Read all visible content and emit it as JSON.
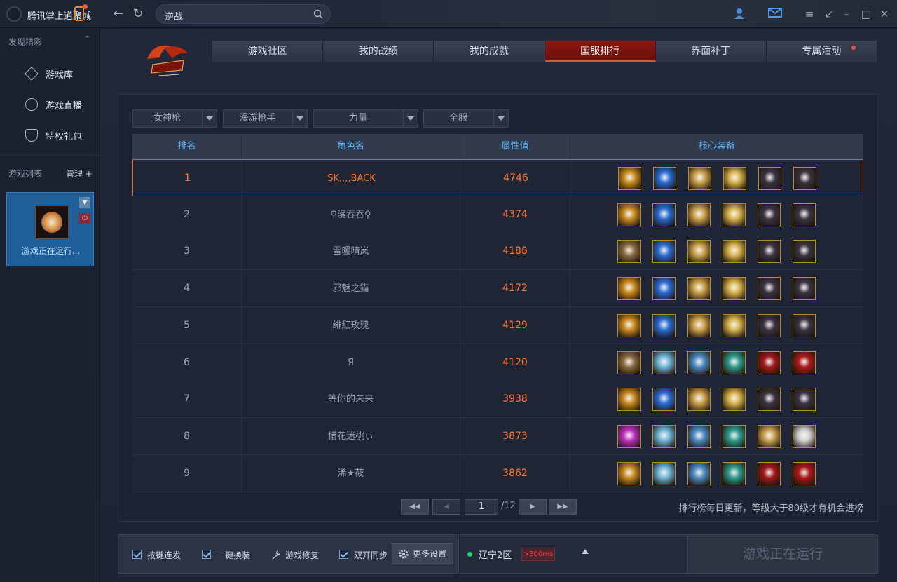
{
  "app": {
    "title": "腾讯掌上道聚城"
  },
  "search": {
    "value": "逆战"
  },
  "sidebar": {
    "discover_header": "发现精彩",
    "items": [
      {
        "label": "游戏库",
        "icon": "game-library-icon"
      },
      {
        "label": "游戏直播",
        "icon": "play-circle-icon"
      },
      {
        "label": "特权礼包",
        "icon": "shield-gift-icon"
      }
    ],
    "gamelist_header": "游戏列表",
    "manage_label": "管理 +",
    "game_card": {
      "status": "游戏正在运行..."
    }
  },
  "tabs": [
    {
      "label": "游戏社区",
      "active": false
    },
    {
      "label": "我的战绩",
      "active": false
    },
    {
      "label": "我的成就",
      "active": false
    },
    {
      "label": "国服排行",
      "active": true
    },
    {
      "label": "界面补丁",
      "active": false
    },
    {
      "label": "专属活动",
      "active": false,
      "badge": true
    }
  ],
  "filters": [
    "女神枪",
    "漫游枪手",
    "力量",
    "全服"
  ],
  "table": {
    "headers": [
      "排名",
      "角色名",
      "属性值",
      "核心装备"
    ],
    "rows": [
      {
        "rank": "1",
        "name": "SK,,,,BACK",
        "value": "4746",
        "equip_set": "gold"
      },
      {
        "rank": "2",
        "name": "♀漫吞吞♀",
        "value": "4374",
        "equip_set": "gold"
      },
      {
        "rank": "3",
        "name": "雪暖晴岚",
        "value": "4188",
        "equip_set": "gold2"
      },
      {
        "rank": "4",
        "name": "邪魅之猫",
        "value": "4172",
        "equip_set": "gold"
      },
      {
        "rank": "5",
        "name": "绯紅玫瑰",
        "value": "4129",
        "equip_set": "gold"
      },
      {
        "rank": "6",
        "name": "Я",
        "value": "4120",
        "equip_set": "ice"
      },
      {
        "rank": "7",
        "name": "等你的未来",
        "value": "3938",
        "equip_set": "gold"
      },
      {
        "rank": "8",
        "name": "惜花迷桃ぃ",
        "value": "3873",
        "equip_set": "pink"
      },
      {
        "rank": "9",
        "name": "浠★莜",
        "value": "3862",
        "equip_set": "ice2"
      }
    ]
  },
  "pager": {
    "current": "1",
    "total": "/12"
  },
  "notice": "排行榜每日更新，等级大于80级才有机会进榜",
  "bottom": {
    "checkboxes": [
      "按键连发",
      "一键换装",
      "双开同步"
    ],
    "repair_label": "游戏修复",
    "more_settings_label": "更多设置",
    "server_name": "辽宁2区",
    "ping": ">300ms",
    "running_label": "游戏正在运行"
  },
  "colors": {
    "accent": "#ff7a2e",
    "header_text": "#5cb3f5",
    "active_tab": "#8c1610"
  }
}
